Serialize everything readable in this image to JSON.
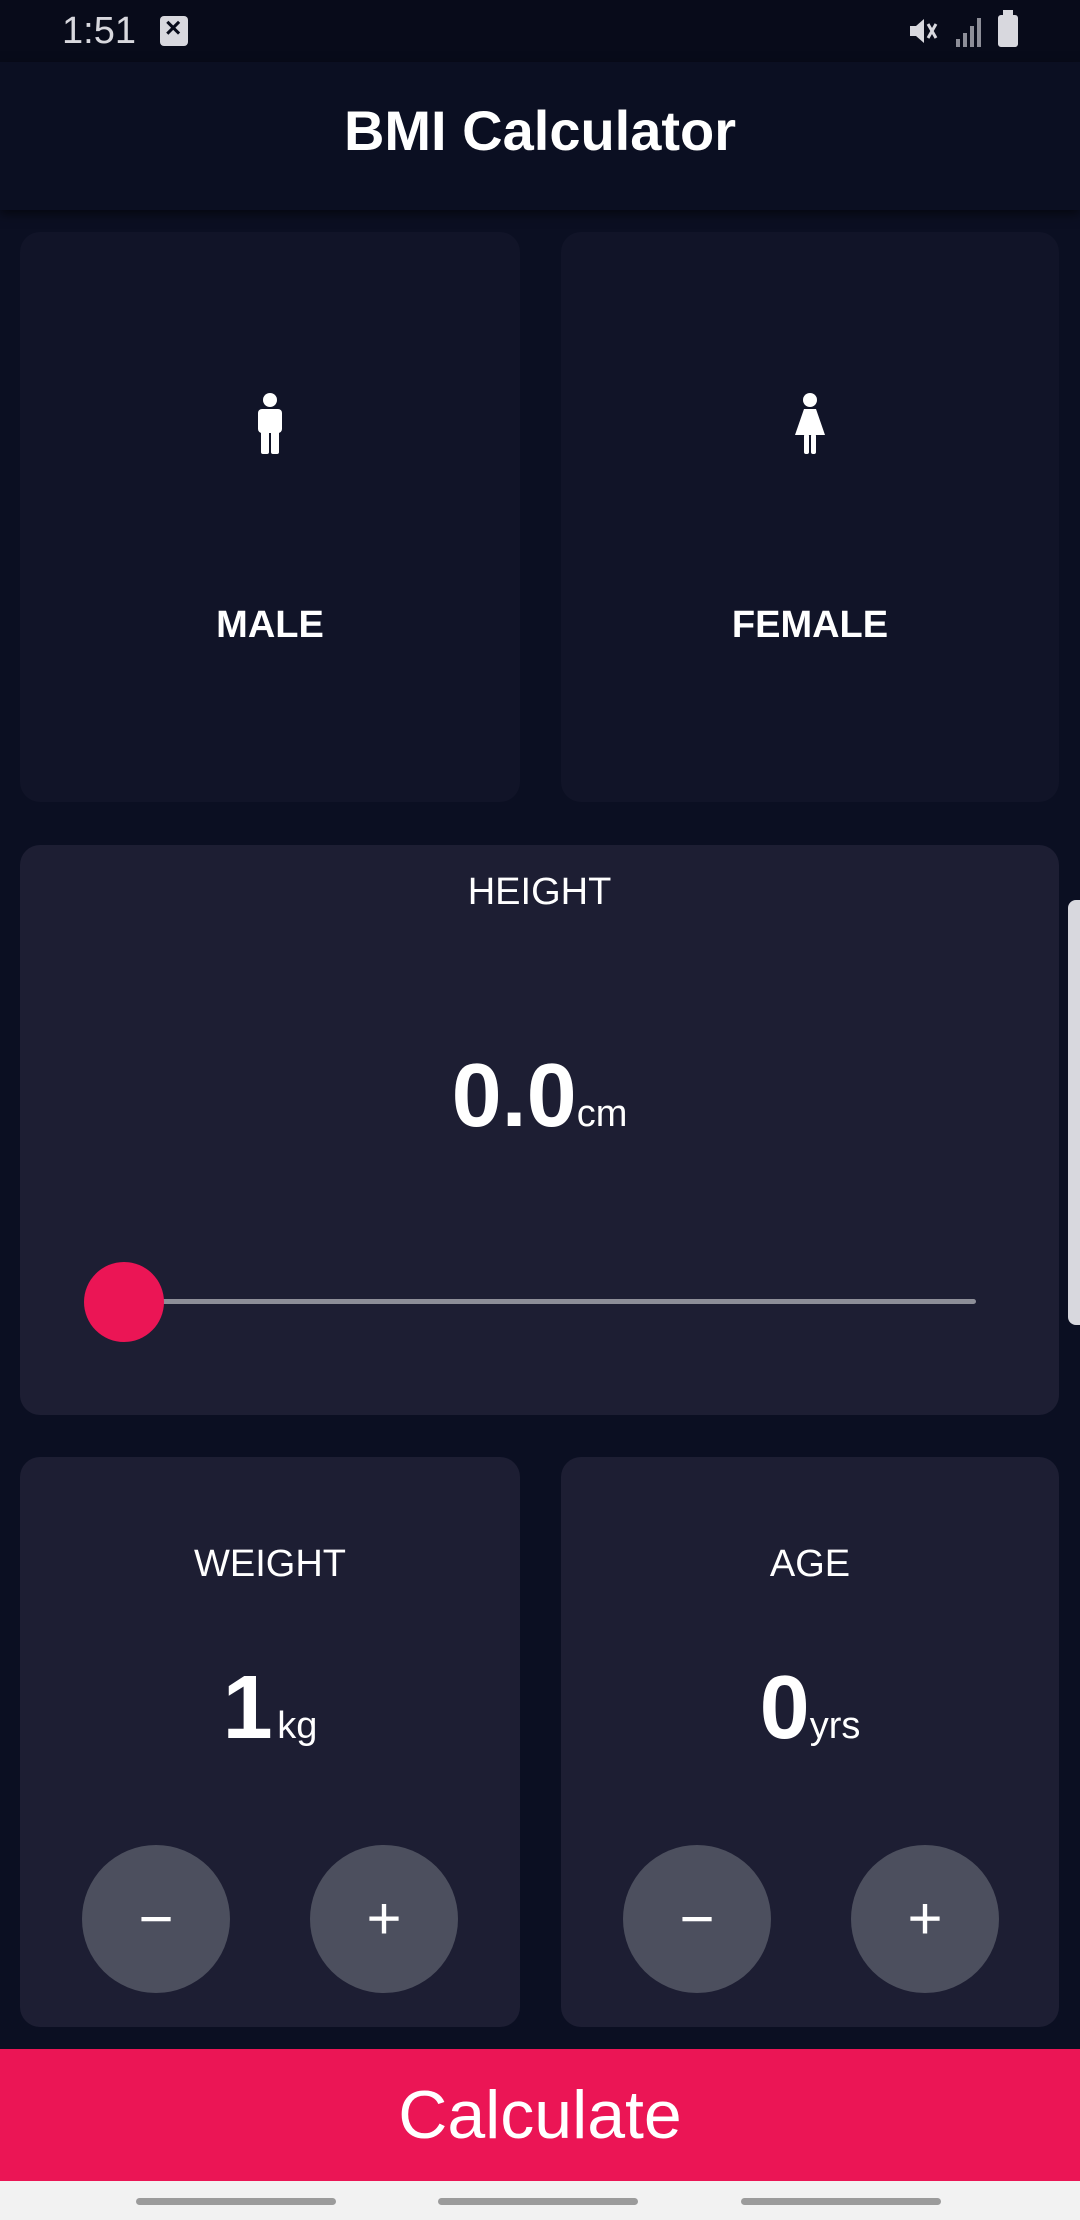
{
  "status_bar": {
    "time": "1:51"
  },
  "app_bar": {
    "title": "BMI Calculator"
  },
  "gender": {
    "male_label": "MALE",
    "female_label": "FEMALE"
  },
  "height": {
    "label": "HEIGHT",
    "value": "0.0",
    "unit": "cm",
    "slider_fraction": 0
  },
  "weight": {
    "label": "WEIGHT",
    "value": "1",
    "unit": "kg",
    "minus": "−",
    "plus": "+"
  },
  "age": {
    "label": "AGE",
    "value": "0",
    "unit": "yrs",
    "minus": "−",
    "plus": "+"
  },
  "calculate_label": "Calculate",
  "colors": {
    "background": "#0b0f22",
    "card": "#1d1e33",
    "accent": "#eb1555",
    "round_button": "#4c4f5e"
  },
  "icons": {
    "male": "male-icon",
    "female": "female-icon",
    "mute": "mute-icon",
    "signal": "signal-icon",
    "battery": "battery-icon",
    "notification": "notification-icon"
  }
}
